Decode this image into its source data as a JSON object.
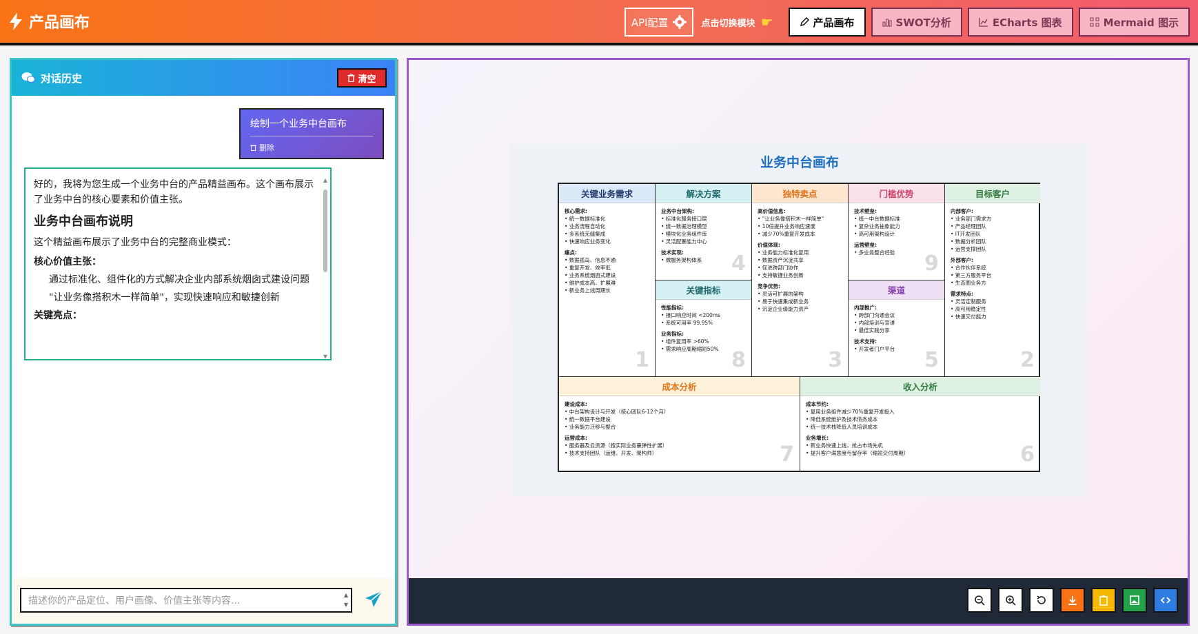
{
  "header": {
    "app_title": "产品画布",
    "api_config": "API配置",
    "switch_label": "点击切换模块",
    "tabs": [
      {
        "label": "产品画布",
        "active": true
      },
      {
        "label": "SWOT分析",
        "active": false
      },
      {
        "label": "ECharts 图表",
        "active": false
      },
      {
        "label": "Mermaid 图示",
        "active": false
      }
    ]
  },
  "chat": {
    "title": "对话历史",
    "clear_label": "清空",
    "user_message": "绘制一个业务中台画布",
    "delete_label": "删除",
    "ai_intro": "好的，我将为您生成一个业务中台的产品精益画布。这个画布展示了业务中台的核心要素和价值主张。",
    "ai_heading": "业务中台画布说明",
    "ai_desc": "这个精益画布展示了业务中台的完整商业模式：",
    "ai_core": "核心价值主张：",
    "ai_point1": "通过标准化、组件化的方式解决企业内部系统烟囱式建设问题",
    "ai_point2": "\"让业务像搭积木一样简单\"，实现快速响应和敏捷创新",
    "ai_more": "关键亮点：",
    "input_placeholder": "描述你的产品定位、用户画像、价值主张等内容..."
  },
  "canvas": {
    "title": "业务中台画布",
    "colors": {
      "problem": "#dbe8f7",
      "solution": "#d6f1f3",
      "uvp": "#fde6cf",
      "advantage": "#fbe1ea",
      "segments": "#dff1e2",
      "metrics": "#d6f1f3",
      "channels": "#efe1f5",
      "cost": "#fdf1d9",
      "revenue": "#dff1e2"
    },
    "cells": {
      "problem": {
        "title": "关键业务需求",
        "number": "1",
        "sections": [
          {
            "h": "核心需求:",
            "items": [
              "统一数据标准化",
              "业务流程自动化",
              "多系统无缝集成",
              "快速响应业务变化"
            ]
          },
          {
            "h": "痛点:",
            "items": [
              "数据孤岛、信息不通",
              "重复开发、效率低",
              "业务系统烟囱式建设",
              "维护成本高、扩展难",
              "新业务上线周期长"
            ]
          }
        ]
      },
      "solution": {
        "title": "解决方案",
        "number": "4",
        "sections": [
          {
            "h": "业务中台架构:",
            "items": [
              "标准化服务接口层",
              "统一数据治理模型",
              "模块化业务组件库",
              "灵活配置能力中心"
            ]
          },
          {
            "h": "技术实现:",
            "items": [
              "微服务架构体系"
            ]
          }
        ]
      },
      "metrics": {
        "title": "关键指标",
        "number": "8",
        "sections": [
          {
            "h": "性能指标:",
            "items": [
              "接口响应时间 <200ms",
              "系统可用率 99.95%"
            ]
          },
          {
            "h": "业务指标:",
            "items": [
              "组件复用率 >60%",
              "需求响应周期缩短50%"
            ]
          }
        ]
      },
      "uvp": {
        "title": "独特卖点",
        "number": "3",
        "sections": [
          {
            "h": "高价值信息:",
            "items": [
              "\"让业务像搭积木一样简单\"",
              "10倍提升业务响应速度",
              "减少70%重复开发成本"
            ]
          },
          {
            "h": "价值体现:",
            "items": [
              "业务能力标准化复用",
              "数据资产沉淀共享",
              "促进跨部门协作",
              "支持敏捷业务创新"
            ]
          },
          {
            "h": "竞争优势:",
            "items": [
              "灵活可扩展的架构",
              "易于快速集成新业务",
              "沉淀企业级能力资产"
            ]
          }
        ]
      },
      "advantage": {
        "title": "门槛优势",
        "number": "9",
        "sections": [
          {
            "h": "技术壁垒:",
            "items": [
              "统一中台数据标准",
              "复杂业务抽象能力",
              "高可用架构设计"
            ]
          },
          {
            "h": "运营壁垒:",
            "items": [
              "多业务整合经验"
            ]
          }
        ]
      },
      "channels": {
        "title": "渠道",
        "number": "5",
        "sections": [
          {
            "h": "内部推广:",
            "items": [
              "跨部门沟通会议",
              "内部培训与宣讲",
              "最佳实践分享"
            ]
          },
          {
            "h": "技术支持:",
            "items": [
              "开发者门户平台"
            ]
          }
        ]
      },
      "segments": {
        "title": "目标客户",
        "number": "2",
        "sections": [
          {
            "h": "内部客户:",
            "items": [
              "业务部门需求方",
              "产品经理团队",
              "IT开发团队",
              "数据分析团队",
              "运营支撑团队"
            ]
          },
          {
            "h": "外部客户:",
            "items": [
              "合作伙伴系统",
              "第三方服务平台",
              "生态圈业务方"
            ]
          },
          {
            "h": "需求特点:",
            "items": [
              "灵活定制服务",
              "高可用稳定性",
              "快速交付能力"
            ]
          }
        ]
      },
      "cost": {
        "title": "成本分析",
        "number": "7",
        "sections": [
          {
            "h": "建设成本:",
            "items": [
              "中台架构设计与开发（核心团队6-12个月）",
              "统一数据平台建设",
              "业务能力迁移与整合"
            ]
          },
          {
            "h": "运营成本:",
            "items": [
              "服务器及云资源（按实际业务量弹性扩展）",
              "技术支持团队（运维、开发、架构师）"
            ]
          }
        ]
      },
      "revenue": {
        "title": "收入分析",
        "number": "6",
        "sections": [
          {
            "h": "成本节约:",
            "items": [
              "复用业务组件减少70%重复开发投入",
              "降低系统维护及技术债务成本",
              "统一技术栈降低人员培训成本"
            ]
          },
          {
            "h": "业务增长:",
            "items": [
              "新业务快速上线，抢占市场先机",
              "提升客户满意度与留存率（缩短交付周期）"
            ]
          }
        ]
      }
    }
  },
  "toolbar": {
    "buttons": [
      {
        "name": "zoom-out-button",
        "icon": "zoom-out-icon",
        "color": "#ffffff"
      },
      {
        "name": "zoom-in-button",
        "icon": "zoom-in-icon",
        "color": "#ffffff"
      },
      {
        "name": "reset-button",
        "icon": "reset-icon",
        "color": "#ffffff"
      },
      {
        "name": "download-button",
        "icon": "download-icon",
        "color": "#f97316"
      },
      {
        "name": "copy-button",
        "icon": "clipboard-icon",
        "color": "#f6b800"
      },
      {
        "name": "image-button",
        "icon": "image-icon",
        "color": "#22a34a"
      },
      {
        "name": "code-button",
        "icon": "code-icon",
        "color": "#2f7de1"
      }
    ]
  }
}
